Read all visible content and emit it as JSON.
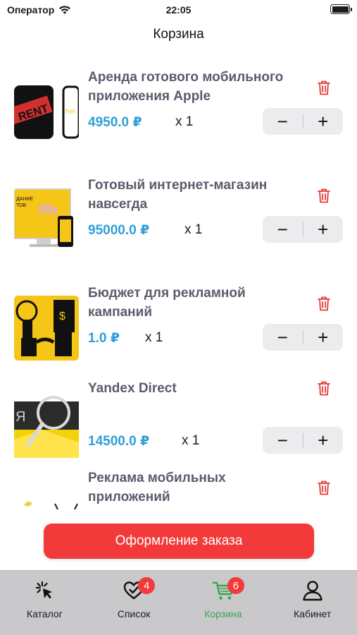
{
  "status_bar": {
    "carrier": "Оператор",
    "time": "22:05"
  },
  "nav": {
    "title": "Корзина"
  },
  "cart": {
    "items": [
      {
        "name": "Аренда готового мобильного приложения Apple",
        "price": "4950.0 ₽",
        "quantity": "x 1",
        "image": "apple-app-rental-thumbnail"
      },
      {
        "name": " Готовый интернет-магазин навсегда",
        "price": "95000.0 ₽",
        "quantity": "x 1",
        "image": "online-store-thumbnail"
      },
      {
        "name": "Бюджет для рекламной кампаний",
        "price": "1.0 ₽",
        "quantity": "x 1",
        "image": "ad-budget-thumbnail"
      },
      {
        "name": "Yandex Direct",
        "price": "14500.0 ₽",
        "quantity": "x 1",
        "image": "yandex-direct-thumbnail"
      },
      {
        "name": "Реклама мобильных приложений",
        "price": "",
        "quantity": "",
        "image": "mobile-app-ads-thumbnail"
      }
    ],
    "stepper": {
      "minus": "−",
      "plus": "+"
    }
  },
  "checkout": {
    "label": "Оформление заказа"
  },
  "tabs": [
    {
      "label": "Каталог",
      "icon": "catalog-cursor-icon",
      "badge": ""
    },
    {
      "label": "Список",
      "icon": "heart-check-icon",
      "badge": "4"
    },
    {
      "label": "Корзина",
      "icon": "cart-icon",
      "badge": "6",
      "active": true
    },
    {
      "label": "Кабинет",
      "icon": "person-icon",
      "badge": ""
    }
  ],
  "colors": {
    "price": "#2e9fd8",
    "accent_red": "#f23a3a",
    "active_tab": "#3aa64a",
    "tab_bar": "#c9c9cc"
  }
}
